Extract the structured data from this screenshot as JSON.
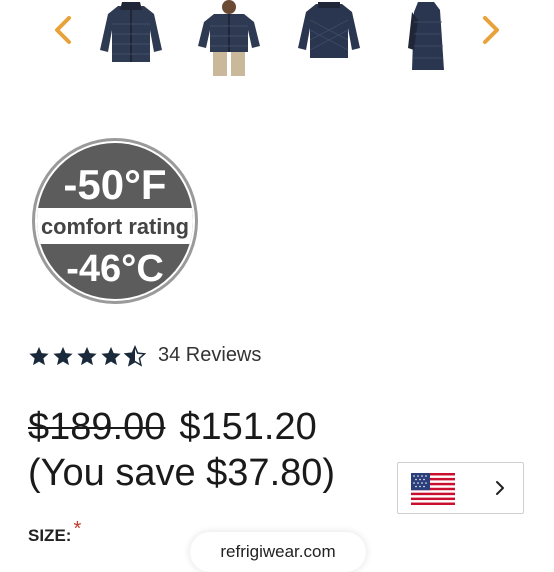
{
  "carousel": {
    "prev_icon": "chevron-left-icon",
    "next_icon": "chevron-right-icon",
    "arrow_color": "#e8a23a"
  },
  "badge": {
    "fahrenheit": "-50°F",
    "comfort_label": "comfort rating",
    "celsius": "-46°C"
  },
  "rating": {
    "stars": 4.5,
    "reviews_label": "34 Reviews"
  },
  "price": {
    "original": "$189.00",
    "sale": "$151.20",
    "savings_text": "(You save $37.80)"
  },
  "language_selector": {
    "flag_icon": "us-flag-icon",
    "chevron_icon": "chevron-right-icon"
  },
  "size": {
    "label": "SIZE:",
    "required_mark": "*"
  },
  "url_bar": {
    "domain": "refrigiwear.com"
  }
}
